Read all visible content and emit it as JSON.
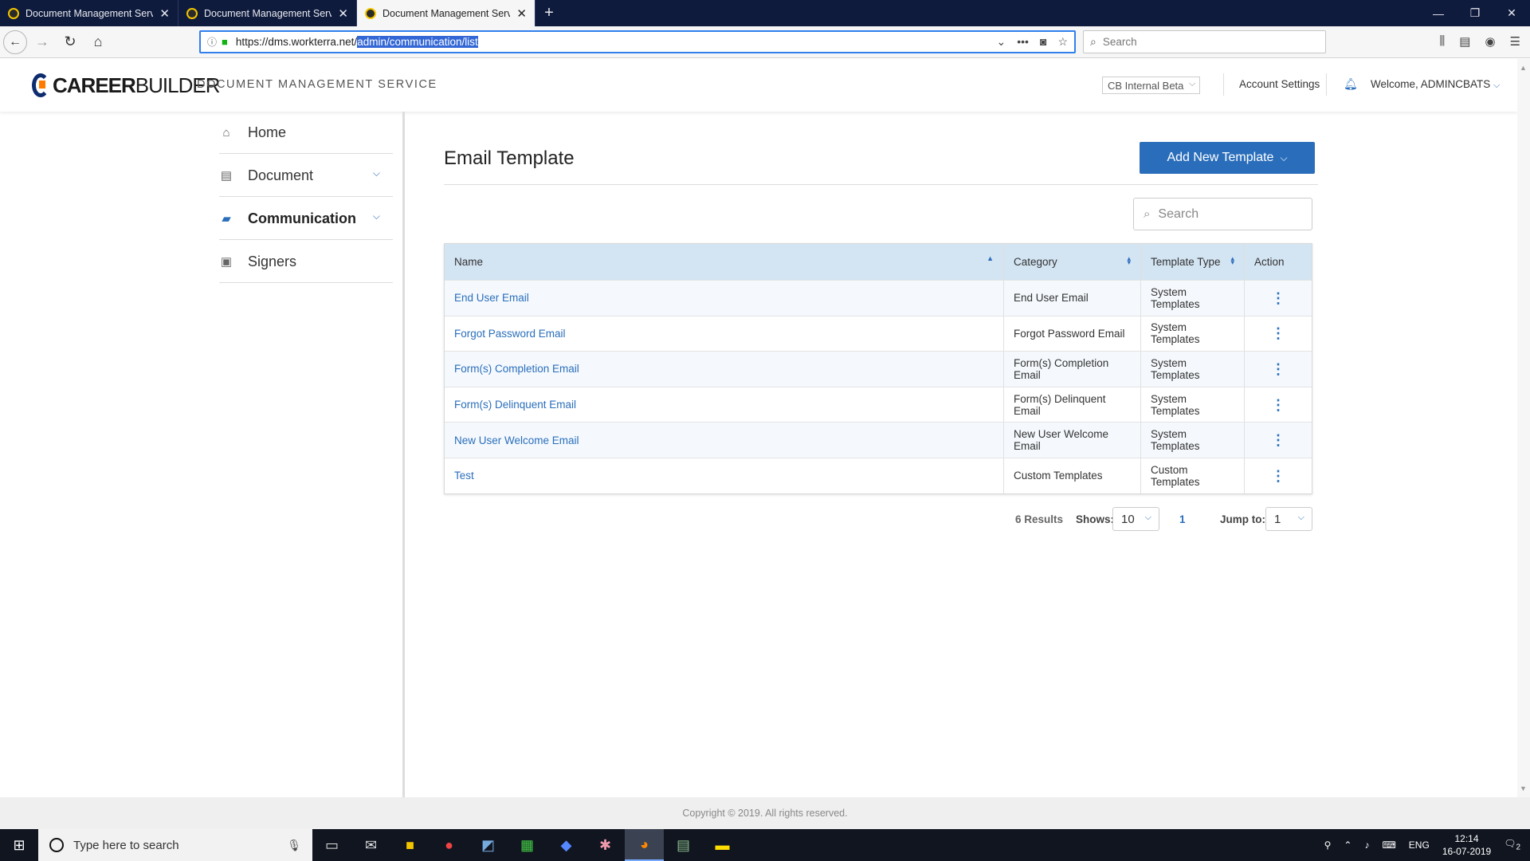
{
  "browser": {
    "tabs": [
      {
        "title": "Document Management Servic",
        "active": false
      },
      {
        "title": "Document Management Servic",
        "active": false
      },
      {
        "title": "Document Management Servic",
        "active": true
      }
    ],
    "url_base": "https://dms.workterra.net/",
    "url_path": "admin/communication/list",
    "search_placeholder": "Search"
  },
  "header": {
    "logo_bold": "CAREER",
    "logo_light": "BUILDER",
    "app_title": "DOCUMENT MANAGEMENT SERVICE",
    "environment": "CB Internal Beta",
    "account_settings": "Account Settings",
    "welcome": "Welcome, ADMINCBATS"
  },
  "sidebar": {
    "items": [
      {
        "label": "Home",
        "icon": "home-icon",
        "active": false,
        "expandable": false
      },
      {
        "label": "Document",
        "icon": "document-icon",
        "active": false,
        "expandable": true
      },
      {
        "label": "Communication",
        "icon": "chat-icon",
        "active": true,
        "expandable": true
      },
      {
        "label": "Signers",
        "icon": "id-badge-icon",
        "active": false,
        "expandable": false
      }
    ]
  },
  "main": {
    "title": "Email Template",
    "add_button": "Add New Template",
    "search_placeholder": "Search",
    "table": {
      "columns": [
        "Name",
        "Category",
        "Template Type",
        "Action"
      ],
      "rows": [
        {
          "name": "End User Email",
          "category": "End User Email",
          "type": "System Templates"
        },
        {
          "name": "Forgot Password Email",
          "category": "Forgot Password Email",
          "type": "System Templates"
        },
        {
          "name": "Form(s) Completion Email",
          "category": "Form(s) Completion Email",
          "type": "System Templates"
        },
        {
          "name": "Form(s) Delinquent Email",
          "category": "Form(s) Delinquent Email",
          "type": "System Templates"
        },
        {
          "name": "New User Welcome Email",
          "category": "New User Welcome Email",
          "type": "System Templates"
        },
        {
          "name": "Test",
          "category": "Custom Templates",
          "type": "Custom Templates"
        }
      ]
    },
    "pagination": {
      "results": "6 Results",
      "shows_label": "Shows:",
      "shows_value": "10",
      "page": "1",
      "jump_label": "Jump to:",
      "jump_value": "1"
    }
  },
  "footer": {
    "copyright": "Copyright © 2019. All rights reserved."
  },
  "taskbar": {
    "search_placeholder": "Type here to search",
    "lang": "ENG",
    "time": "12:14",
    "date": "16-07-2019",
    "notifications": "2"
  },
  "colors": {
    "accent": "#2a6ebb",
    "table_header": "#d3e4f3",
    "tabbar": "#0f1b3d"
  }
}
